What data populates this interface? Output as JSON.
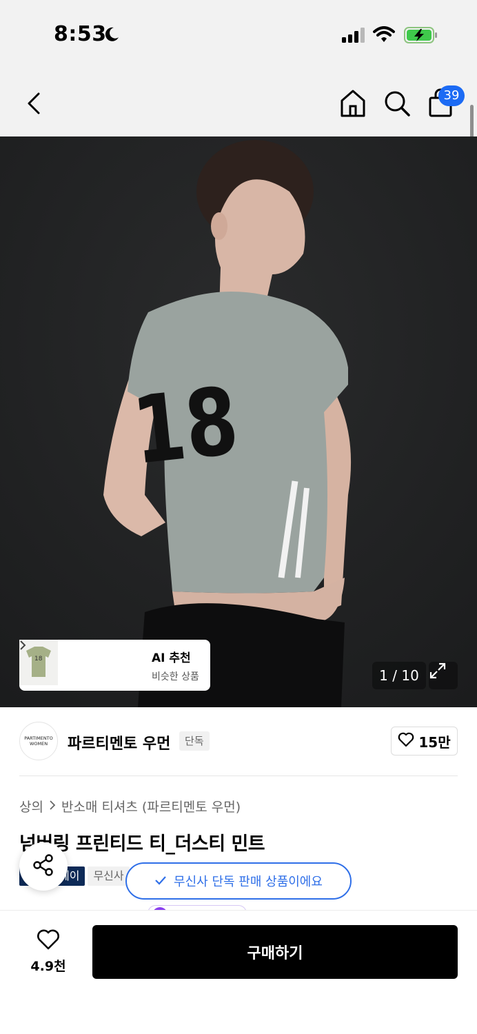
{
  "status_bar": {
    "time": "8:53",
    "icons": [
      "moon-icon",
      "signal-icon",
      "wifi-icon",
      "battery-charging-icon"
    ]
  },
  "header": {
    "icons": [
      "back-icon",
      "home-icon",
      "search-icon",
      "cart-icon"
    ],
    "cart_count": "39"
  },
  "gallery": {
    "counter": "1 / 10",
    "ai_recommend": {
      "title": "AI 추천",
      "subtitle": "비슷한 상품"
    },
    "expand_icon": "expand-icon"
  },
  "brand": {
    "logo_line1": "PARTIMENTO",
    "logo_line2": "WOMEN",
    "name": "파르티멘토 우먼",
    "tag": "단독",
    "likes": "15만"
  },
  "product": {
    "breadcrumb": [
      "상의",
      "반소매 티셔츠 (파르티멘토 우먼)"
    ],
    "title": "넘버링 프린티드 티_더스티 민트",
    "tags": [
      "페이",
      "무신사"
    ]
  },
  "toast": {
    "text": "무신사 단독 판매 상품이에요"
  },
  "bottom_bar": {
    "wish_count": "4.9천",
    "buy_label": "구매하기"
  },
  "colors": {
    "accent_blue": "#2f6fe8",
    "badge_blue": "#1c6bf4",
    "buy_button": "#000000",
    "shirt": "#9aa39f"
  }
}
